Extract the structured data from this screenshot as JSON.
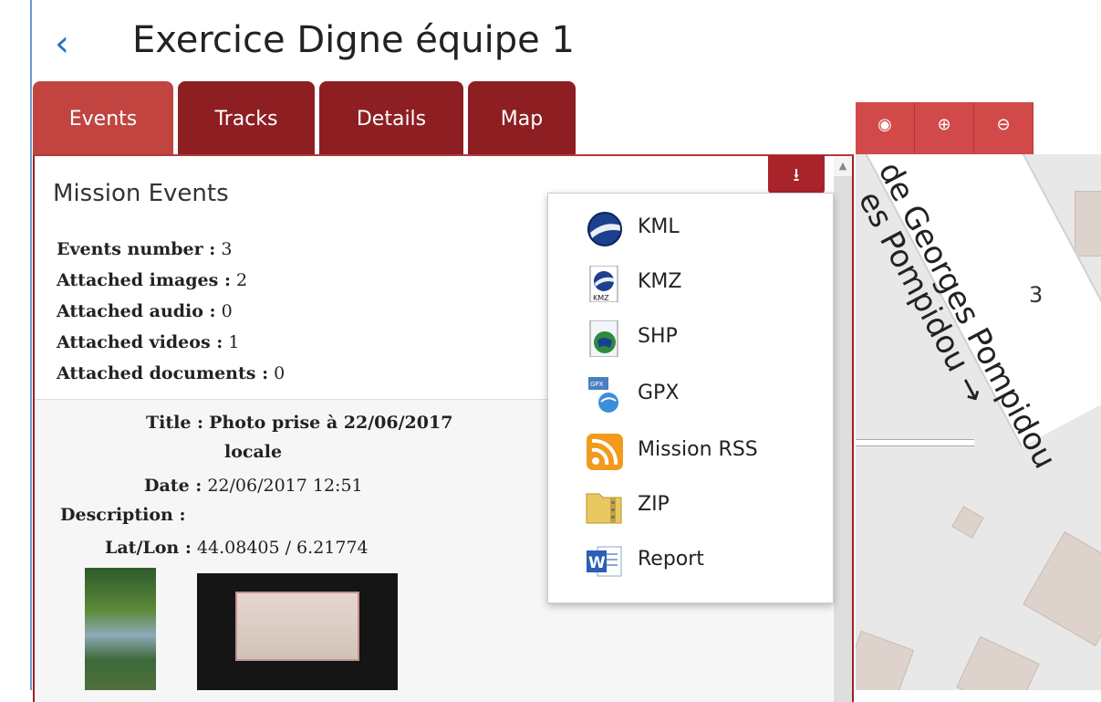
{
  "header": {
    "back_glyph": "‹",
    "title": "Exercice Digne équipe 1"
  },
  "tabs": [
    {
      "label": "Events",
      "active": true
    },
    {
      "label": "Tracks",
      "active": false
    },
    {
      "label": "Details",
      "active": false
    },
    {
      "label": "Map",
      "active": false
    }
  ],
  "map_controls": [
    {
      "icon": "globe-icon",
      "glyph": "◉"
    },
    {
      "icon": "zoom-in-icon",
      "glyph": "⊕"
    },
    {
      "icon": "zoom-out-icon",
      "glyph": "⊖"
    }
  ],
  "download": {
    "icon": "download-icon",
    "glyph": "⭳"
  },
  "mission": {
    "title": "Mission Events",
    "stats": [
      {
        "label": "Events number :",
        "value": "3"
      },
      {
        "label": "Attached images :",
        "value": "2"
      },
      {
        "label": "Attached audio :",
        "value": "0"
      },
      {
        "label": "Attached videos :",
        "value": "1"
      },
      {
        "label": "Attached documents :",
        "value": "0"
      }
    ]
  },
  "event": {
    "title_label": "Title :",
    "title_value_line1": "Photo prise à 22/06/2017",
    "title_value_line2": "locale",
    "date_label": "Date :",
    "date_value": "22/06/2017 12:51",
    "description_label": "Description :",
    "latlon_label": "Lat/Lon :",
    "latlon_value": "44.08405 / 6.21774"
  },
  "export_menu": [
    {
      "label": "KML",
      "icon": "google-earth-icon"
    },
    {
      "label": "KMZ",
      "icon": "kmz-file-icon"
    },
    {
      "label": "SHP",
      "icon": "shp-file-icon"
    },
    {
      "label": "GPX",
      "icon": "gpx-file-icon"
    },
    {
      "label": "Mission RSS",
      "icon": "rss-icon"
    },
    {
      "label": "ZIP",
      "icon": "zip-archive-icon"
    },
    {
      "label": "Report",
      "icon": "word-document-icon"
    }
  ],
  "map": {
    "street_line1": "de Georges Pompidou",
    "street_line2": "es Pompidou →",
    "marker_number": "3"
  },
  "colors": {
    "tab_active": "#c14440",
    "tab_inactive": "#8d1f22",
    "accent_link": "#2a6fc7"
  }
}
